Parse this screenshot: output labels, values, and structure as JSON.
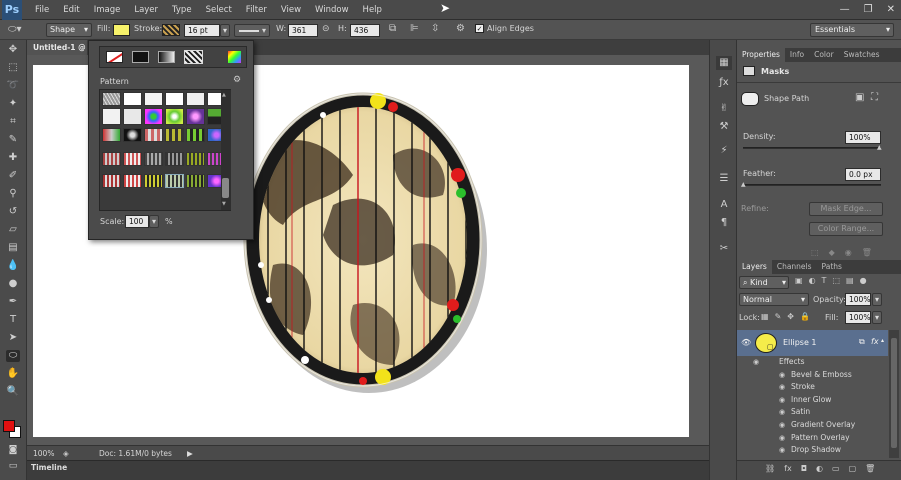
{
  "app": {
    "logo": "Ps"
  },
  "menu": [
    "File",
    "Edit",
    "Image",
    "Layer",
    "Type",
    "Select",
    "Filter",
    "View",
    "Window",
    "Help"
  ],
  "window_controls": {
    "minimize": "—",
    "restore": "❐",
    "close": "✕"
  },
  "options": {
    "mode": "Shape",
    "fill_label": "Fill:",
    "stroke_label": "Stroke:",
    "stroke_size": "16 pt",
    "w_label": "W:",
    "w_value": "361 px",
    "h_label": "H:",
    "h_value": "436 px",
    "align_edges": "Align Edges",
    "workspace": "Essentials",
    "fill_color": "#f7f26a"
  },
  "document": {
    "tab": "Untitled-1 @ 1",
    "zoom": "100%",
    "doc_info": "Doc: 1.61M/0 bytes",
    "timeline": "Timeline"
  },
  "fill_popup": {
    "section": "Pattern",
    "scale_label": "Scale:",
    "scale_value": "100",
    "scale_unit": "%"
  },
  "properties": {
    "tabs": [
      "Properties",
      "Info",
      "Color",
      "Swatches"
    ],
    "header": "Masks",
    "shape_path": "Shape Path",
    "density_label": "Density:",
    "density_value": "100%",
    "feather_label": "Feather:",
    "feather_value": "0.0 px",
    "refine_label": "Refine:",
    "mask_edge": "Mask Edge...",
    "color_range": "Color Range..."
  },
  "layers": {
    "tabs": [
      "Layers",
      "Channels",
      "Paths"
    ],
    "kind": "Kind",
    "blend": "Normal",
    "opacity_label": "Opacity:",
    "opacity_value": "100%",
    "lock_label": "Lock:",
    "fill_label": "Fill:",
    "fill_value": "100%",
    "layer_name": "Ellipse 1",
    "effects_label": "Effects",
    "effects": [
      "Bevel & Emboss",
      "Stroke",
      "Inner Glow",
      "Satin",
      "Gradient Overlay",
      "Pattern Overlay",
      "Drop Shadow"
    ]
  },
  "colors": {
    "foreground": "#e01010",
    "background": "#ffffff"
  }
}
